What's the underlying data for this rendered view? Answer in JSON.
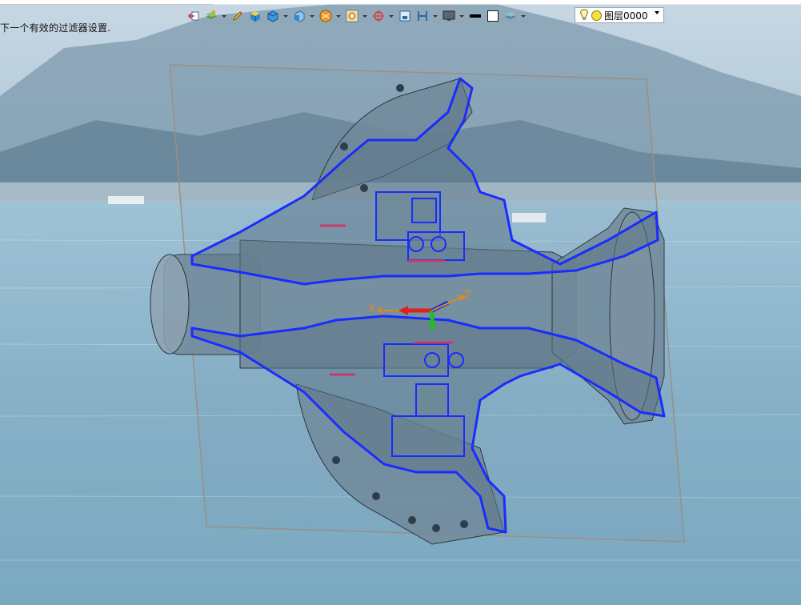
{
  "status_bar": {
    "message": "下一个有效的过滤器设置."
  },
  "toolbar": {
    "items": [
      {
        "icon": "back-arrow-icon"
      },
      {
        "icon": "layer-stack-icon"
      },
      {
        "icon": "pencil-icon"
      },
      {
        "icon": "solid-cube-icon"
      },
      {
        "icon": "cube-view-icon"
      },
      {
        "icon": "cube-orient-icon"
      },
      {
        "icon": "render-ball-icon"
      },
      {
        "icon": "color-wheel-icon"
      },
      {
        "icon": "target-icon"
      },
      {
        "icon": "frame-icon"
      },
      {
        "icon": "section-icon"
      },
      {
        "icon": "monitor-icon"
      },
      {
        "icon": "line-color-icon"
      },
      {
        "icon": "box-outline-icon"
      },
      {
        "icon": "plane-icon"
      }
    ],
    "layer": {
      "name": "图层0000"
    }
  },
  "viewport": {
    "axis_x_label": "X",
    "axis_z_label": "Z"
  },
  "colors": {
    "section_outline": "#1a2cff",
    "part_body": "#6f8796",
    "sky": "#a9c4d9",
    "water": "#8fb6cc"
  }
}
